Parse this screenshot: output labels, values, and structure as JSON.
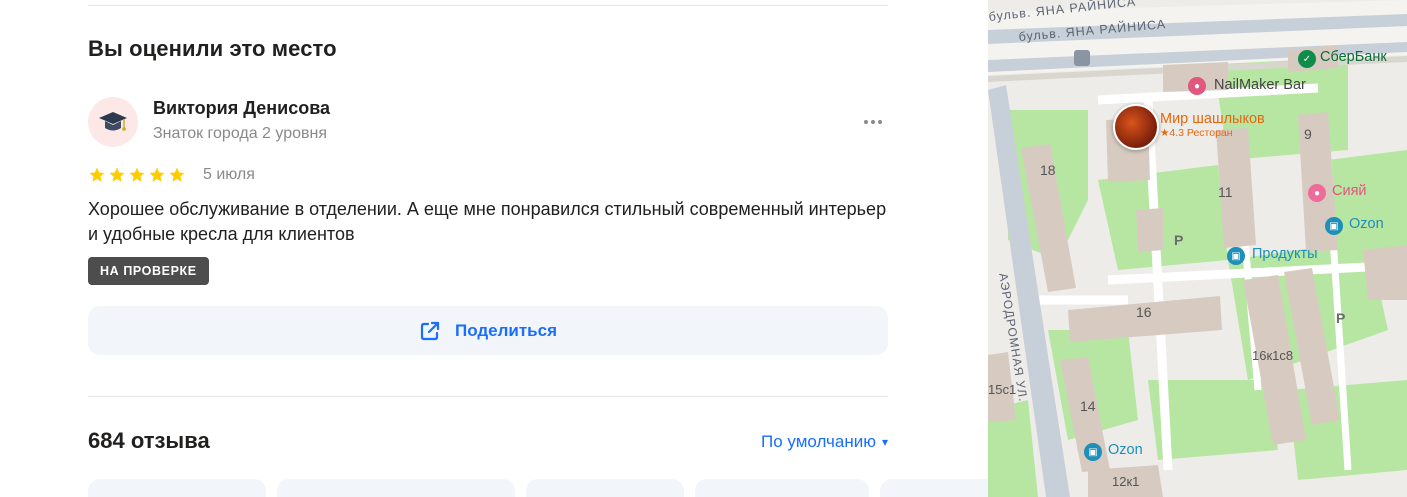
{
  "review": {
    "section_title": "Вы оценили это место",
    "author_name": "Виктория Денисова",
    "author_level": "Знаток города 2 уровня",
    "rating": 5,
    "date": "5 июля",
    "text": "Хорошее обслуживание в отделении. А еще мне понравился стильный современный интерьер и удобные кресла для клиентов",
    "status": "НА ПРОВЕРКЕ",
    "share_label": "Поделиться"
  },
  "reviews": {
    "count_label": "684 отзыва",
    "sort_label": "По умолчанию",
    "sort_arrow": "▾"
  },
  "colors": {
    "accent": "#196dff",
    "star": "#fc0",
    "badge": "#4d4d4d",
    "park": "#b7e6a3",
    "poi_orange": "#e8660e",
    "poi_green": "#0d8c4a",
    "poi_blue": "#1d8fb8"
  },
  "map": {
    "streets": [
      "бульв. ЯНА РАЙНИСА",
      "бульв. ЯНА РАЙНИСА",
      "АЭРОДРОМНАЯ УЛ."
    ],
    "house_numbers": [
      "18",
      "11",
      "9",
      "16",
      "16к1с8",
      "14",
      "15с1",
      "12к1"
    ],
    "parking": [
      "P",
      "P"
    ],
    "pois": {
      "sber": "СберБанк",
      "nailmaker": "NailMaker Bar",
      "restaurant_name": "Мир шашлыков",
      "restaurant_meta": "★4.3 Ресторан",
      "siyai": "Сияй",
      "ozon_1": "Ozon",
      "produkty": "Продукты",
      "ozon_2": "Ozon"
    }
  }
}
